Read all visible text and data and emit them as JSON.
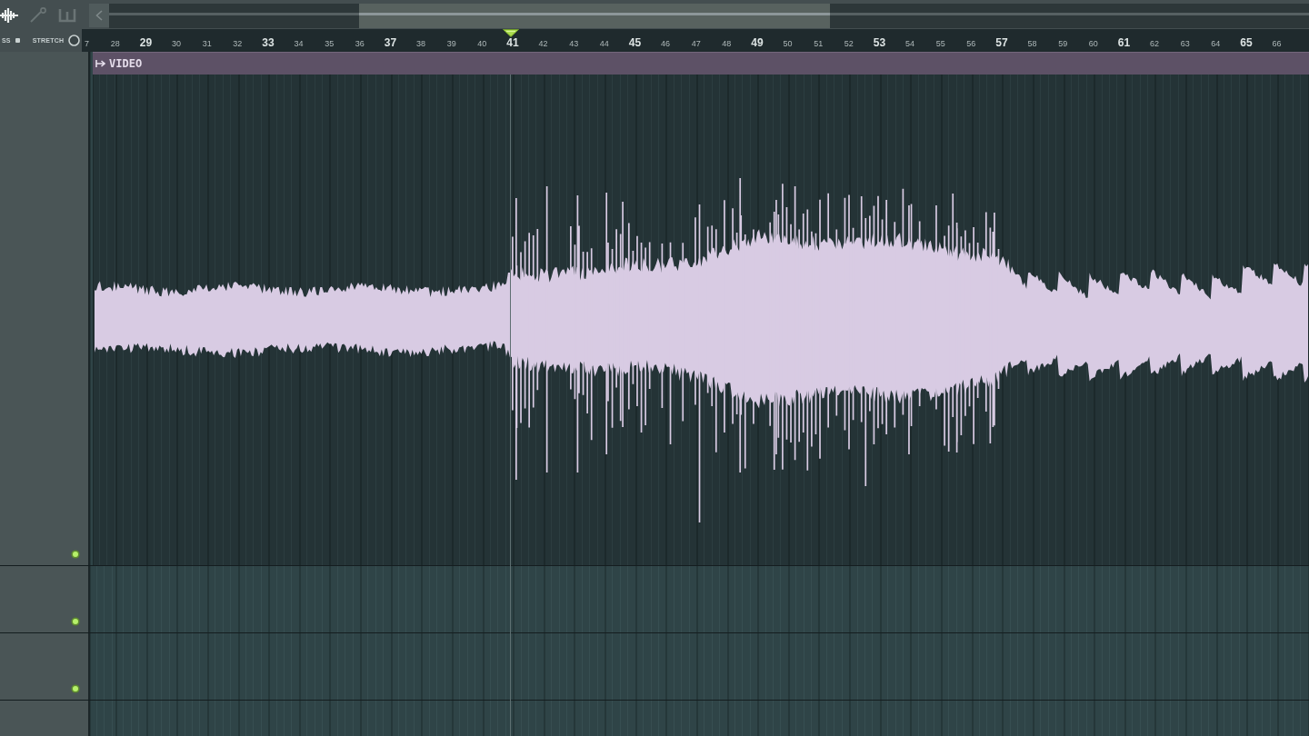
{
  "toolbar": {
    "tools": [
      {
        "kind": "waveform",
        "selected": true
      },
      {
        "kind": "pin",
        "selected": false
      },
      {
        "kind": "comb",
        "selected": false
      }
    ]
  },
  "ruler": {
    "options": [
      {
        "label": "SS",
        "on": true
      },
      {
        "label": "STRETCH",
        "on": false
      }
    ],
    "ticks": [
      {
        "label": "7",
        "major": false
      },
      {
        "label": "28",
        "major": false
      },
      {
        "label": "29",
        "major": true
      },
      {
        "label": "30",
        "major": false
      },
      {
        "label": "31",
        "major": false
      },
      {
        "label": "32",
        "major": false
      },
      {
        "label": "33",
        "major": true
      },
      {
        "label": "34",
        "major": false
      },
      {
        "label": "35",
        "major": false
      },
      {
        "label": "36",
        "major": false
      },
      {
        "label": "37",
        "major": true
      },
      {
        "label": "38",
        "major": false
      },
      {
        "label": "39",
        "major": false
      },
      {
        "label": "40",
        "major": false
      },
      {
        "label": "41",
        "major": true
      },
      {
        "label": "42",
        "major": false
      },
      {
        "label": "43",
        "major": false
      },
      {
        "label": "44",
        "major": false
      },
      {
        "label": "45",
        "major": true
      },
      {
        "label": "46",
        "major": false
      },
      {
        "label": "47",
        "major": false
      },
      {
        "label": "48",
        "major": false
      },
      {
        "label": "49",
        "major": true
      },
      {
        "label": "50",
        "major": false
      },
      {
        "label": "51",
        "major": false
      },
      {
        "label": "52",
        "major": false
      },
      {
        "label": "53",
        "major": true
      },
      {
        "label": "54",
        "major": false
      },
      {
        "label": "55",
        "major": false
      },
      {
        "label": "56",
        "major": false
      },
      {
        "label": "57",
        "major": true
      },
      {
        "label": "58",
        "major": false
      },
      {
        "label": "59",
        "major": false
      },
      {
        "label": "60",
        "major": false
      },
      {
        "label": "61",
        "major": true
      },
      {
        "label": "62",
        "major": false
      },
      {
        "label": "63",
        "major": false
      },
      {
        "label": "64",
        "major": false
      },
      {
        "label": "65",
        "major": true
      },
      {
        "label": "66",
        "major": false
      }
    ]
  },
  "tracks": [
    {
      "enabled": true,
      "clip": {
        "title": "VIDEO"
      }
    },
    {
      "enabled": true
    },
    {
      "enabled": true
    }
  ]
}
